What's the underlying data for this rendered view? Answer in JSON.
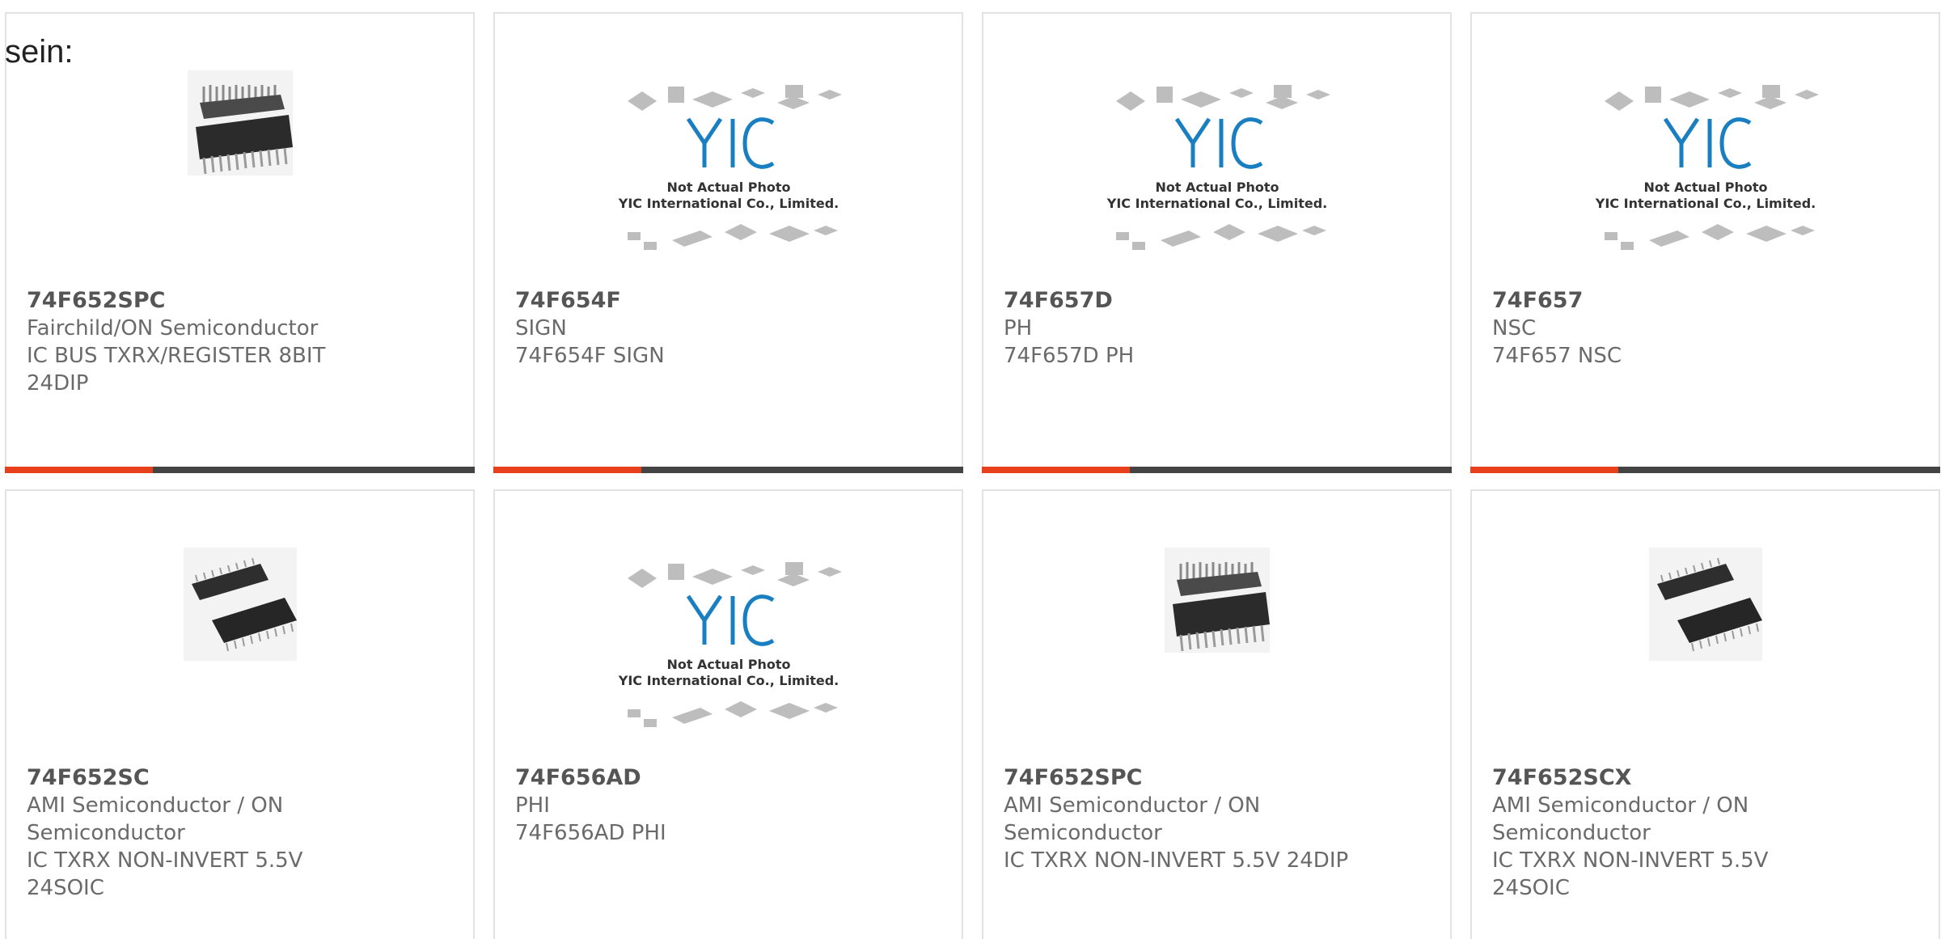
{
  "intro_text": "sein:",
  "products": [
    {
      "part_number": "74F652SPC",
      "manufacturer": "Fairchild/ON Semiconductor",
      "description_lines": [
        "IC BUS TXRX/REGISTER 8BIT",
        "24DIP"
      ],
      "image": "dip-chip-photo"
    },
    {
      "part_number": "74F654F",
      "manufacturer": "SIGN",
      "description_lines": [
        "74F654F SIGN"
      ],
      "image": "yic-placeholder",
      "placeholder_text": [
        "Not Actual Photo",
        "YIC International Co., Limited."
      ]
    },
    {
      "part_number": "74F657D",
      "manufacturer": "PH",
      "description_lines": [
        "74F657D PH"
      ],
      "image": "yic-placeholder",
      "placeholder_text": [
        "Not Actual Photo",
        "YIC International Co., Limited."
      ]
    },
    {
      "part_number": "74F657",
      "manufacturer": "NSC",
      "description_lines": [
        "74F657 NSC"
      ],
      "image": "yic-placeholder",
      "placeholder_text": [
        "Not Actual Photo",
        "YIC International Co., Limited."
      ]
    },
    {
      "part_number": "74F652SC",
      "manufacturer_lines": [
        "AMI Semiconductor / ON",
        "Semiconductor"
      ],
      "description_lines": [
        "IC TXRX NON-INVERT 5.5V",
        "24SOIC"
      ],
      "image": "soic-chip-photo"
    },
    {
      "part_number": "74F656AD",
      "manufacturer": "PHI",
      "description_lines": [
        "74F656AD PHI"
      ],
      "image": "yic-placeholder",
      "placeholder_text": [
        "Not Actual Photo",
        "YIC International Co., Limited."
      ]
    },
    {
      "part_number": "74F652SPC",
      "manufacturer_lines": [
        "AMI Semiconductor / ON",
        "Semiconductor"
      ],
      "description_lines": [
        "IC TXRX NON-INVERT 5.5V 24DIP"
      ],
      "image": "dip-chip-photo"
    },
    {
      "part_number": "74F652SCX",
      "manufacturer_lines": [
        "AMI Semiconductor / ON",
        "Semiconductor"
      ],
      "description_lines": [
        "IC TXRX NON-INVERT 5.5V",
        "24SOIC"
      ],
      "image": "soic-chip-photo"
    }
  ],
  "colors": {
    "accent": "#e8401c",
    "bar_dark": "#444444",
    "text_muted": "#6a6a6a",
    "logo_blue": "#1a7fc1"
  }
}
